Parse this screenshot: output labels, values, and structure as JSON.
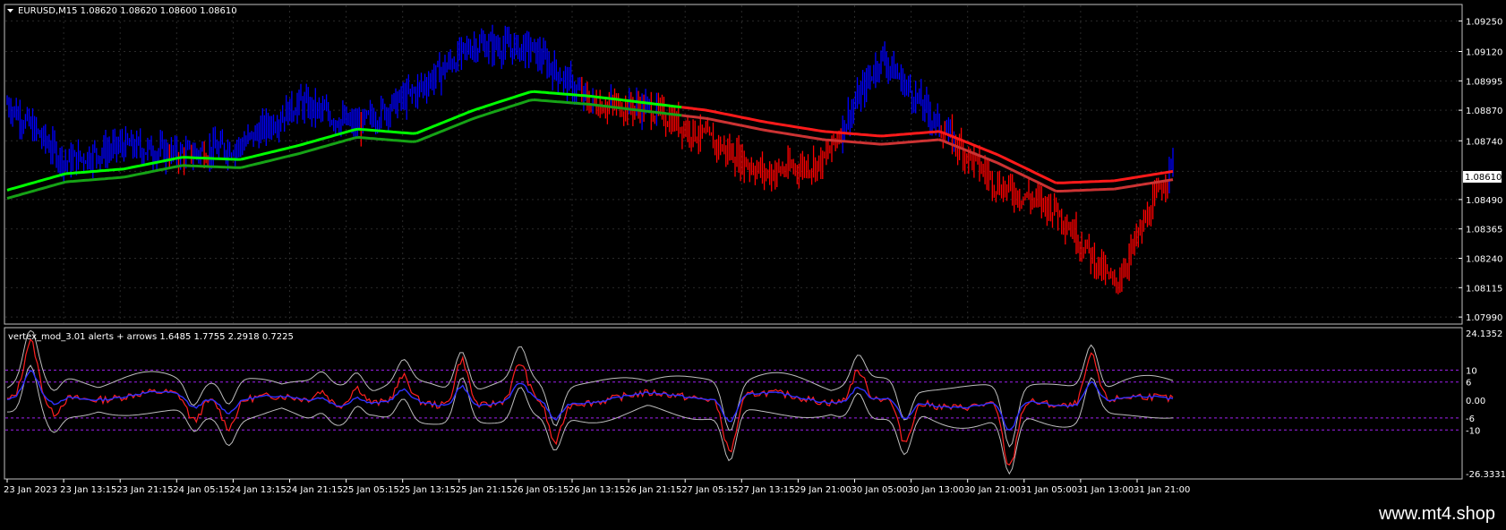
{
  "main_chart": {
    "title": "EURUSD,M15  1.08620 1.08620 1.08600 1.08610",
    "current_price": "1.08610",
    "y_ticks": [
      "1.09250",
      "1.09120",
      "1.08995",
      "1.08870",
      "1.08740",
      "1.08610",
      "1.08490",
      "1.08365",
      "1.08240",
      "1.08115",
      "1.07990"
    ],
    "ylim": [
      1.0796,
      1.0932
    ],
    "colors": {
      "bull": "#0000ff",
      "bear": "#ff0000",
      "ma_up": "#00ff00",
      "ma_up_dark": "#16a316",
      "ma_down": "#ff1a1a",
      "ma_down_dark": "#cc3333"
    }
  },
  "indicator": {
    "title": "vertex_mod_3.01 alerts + arrows 1.6485 1.7755 2.2918 0.7225",
    "y_ticks": [
      "24.1352",
      "10",
      "6",
      "0.00",
      "-6",
      "-10",
      "-26.3331"
    ],
    "ylim": [
      -26.3331,
      24.1352
    ],
    "levels": [
      10,
      6,
      -6,
      -10
    ],
    "level_color": "#a020f0"
  },
  "x_ticks": [
    "23 Jan 2023",
    "23 Jan 13:15",
    "23 Jan 21:15",
    "24 Jan 05:15",
    "24 Jan 13:15",
    "24 Jan 21:15",
    "25 Jan 05:15",
    "25 Jan 13:15",
    "25 Jan 21:15",
    "26 Jan 05:15",
    "26 Jan 13:15",
    "26 Jan 21:15",
    "27 Jan 05:15",
    "27 Jan 13:15",
    "29 Jan 21:00",
    "30 Jan 05:00",
    "30 Jan 13:00",
    "30 Jan 21:00",
    "31 Jan 05:00",
    "31 Jan 13:00",
    "31 Jan 21:00"
  ],
  "watermark": "www.mt4.shop",
  "chart_data": {
    "type": "line",
    "series": [],
    "x": [
      "23 Jan 2023",
      "23 Jan 13:15",
      "23 Jan 21:15",
      "24 Jan 05:15",
      "24 Jan 13:15",
      "24 Jan 21:15",
      "25 Jan 05:15",
      "25 Jan 13:15",
      "25 Jan 21:15",
      "26 Jan 05:15",
      "26 Jan 13:15",
      "26 Jan 21:15",
      "27 Jan 05:15",
      "27 Jan 13:15",
      "29 Jan 21:00",
      "30 Jan 05:00",
      "30 Jan 13:00",
      "30 Jan 21:00",
      "31 Jan 05:00",
      "31 Jan 13:00",
      "31 Jan 21:00"
    ],
    "price": [
      1.089,
      1.0865,
      1.0872,
      1.0868,
      1.0872,
      1.089,
      1.088,
      1.0895,
      1.0915,
      1.0913,
      1.089,
      1.0888,
      1.0875,
      1.086,
      1.0865,
      1.091,
      1.088,
      1.0855,
      1.0845,
      1.0812,
      1.0865
    ],
    "ma_fast": [
      1.0853,
      1.086,
      1.0862,
      1.0867,
      1.0866,
      1.0872,
      1.0879,
      1.0877,
      1.0887,
      1.0895,
      1.0893,
      1.089,
      1.0887,
      1.0882,
      1.0878,
      1.0876,
      1.0878,
      1.0868,
      1.0856,
      1.0857,
      1.0861
    ],
    "ylim": [
      1.0796,
      1.0932
    ]
  }
}
